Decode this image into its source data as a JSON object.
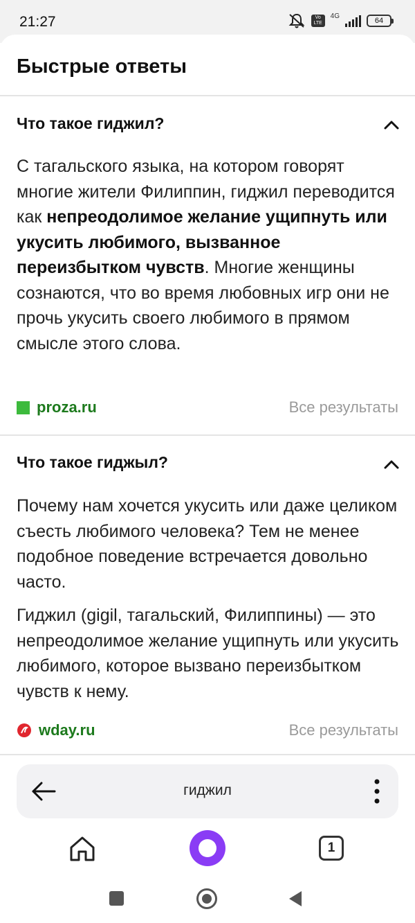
{
  "status_bar": {
    "time": "21:27",
    "network": "4G",
    "volte": "Vo LTE",
    "battery": "64"
  },
  "panel": {
    "title": "Быстрые ответы"
  },
  "answers": [
    {
      "question": "Что такое гиджил?",
      "paragraph_pre": "С тагальского языка, на котором говорят многие жители Филиппин, гиджил переводится как ",
      "paragraph_bold": "непреодолимое желание ущипнуть или укусить любимого, вызванное переизбытком чувств",
      "paragraph_post": ". Многие женщины сознаются, что во время любовных игр они не прочь укусить своего любимого в прямом смысле этого слова.",
      "source": "proza.ru",
      "all_results": "Все результаты"
    },
    {
      "question": "Что такое гиджыл?",
      "paragraph_1": "Почему нам хочется укусить или даже целиком съесть любимого человека? Тем не менее подобное поведение встречается довольно часто.",
      "paragraph_2": "Гиджил (gigil, тагальский, Филиппины) — это непреодолимое желание ущипнуть или укусить любимого, которое вызвано переизбытком чувств к нему.",
      "source": "wday.ru",
      "all_results": "Все результаты"
    }
  ],
  "search_bar": {
    "query": "гиджил"
  },
  "bottom_nav": {
    "tabs_count": "1"
  },
  "colors": {
    "alice_accent": "#8a3cf5",
    "source_green": "#1d7a1d",
    "muted_link": "#9a9a9a",
    "wday_red": "#e0262e"
  }
}
